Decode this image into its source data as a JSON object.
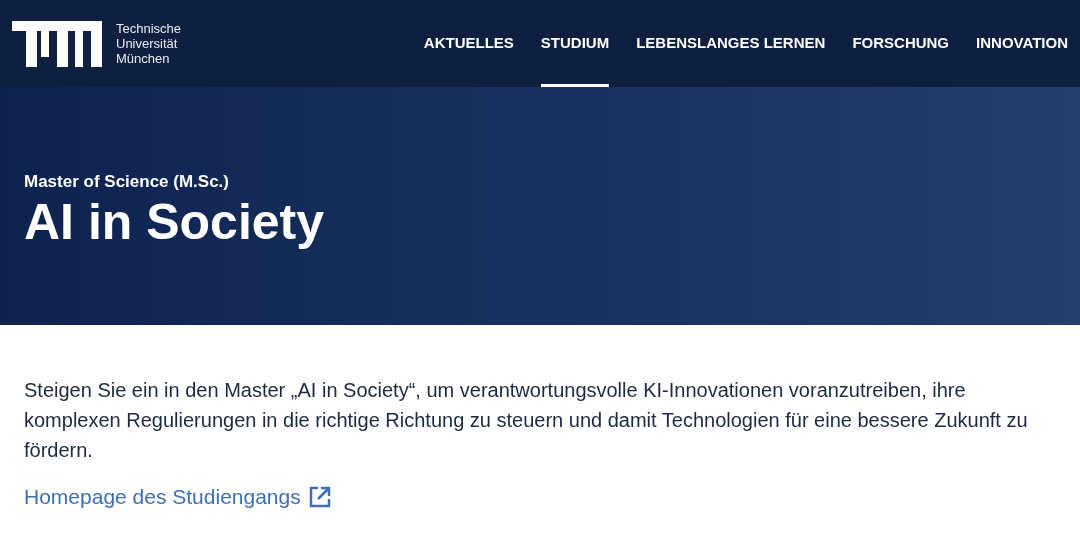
{
  "header": {
    "logo_text": [
      "Technische",
      "Universität",
      "München"
    ],
    "nav": [
      {
        "label": "AKTUELLES",
        "selected": false
      },
      {
        "label": "STUDIUM",
        "selected": true
      },
      {
        "label": "LEBENSLANGES LERNEN",
        "selected": false
      },
      {
        "label": "FORSCHUNG",
        "selected": false
      },
      {
        "label": "INNOVATION",
        "selected": false
      }
    ]
  },
  "hero": {
    "subtitle": "Master of Science (M.Sc.)",
    "title": "AI in Society"
  },
  "intro": {
    "text": "Steigen Sie ein in den Master „AI in Society“, um verantwortungsvolle KI-Innovationen voranzutreiben, ihre komplexen Regulierungen in die richtige Richtung zu steuern und damit Technologien für eine bessere Zukunft zu fördern.",
    "link": "Homepage des Studiengangs"
  }
}
